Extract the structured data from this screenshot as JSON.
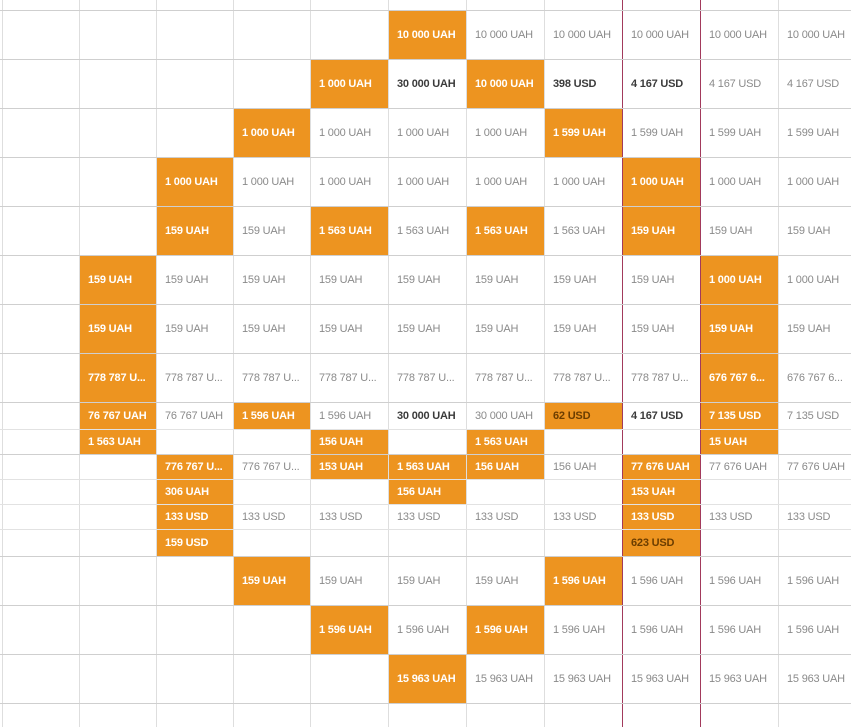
{
  "colors": {
    "highlight": "#ed9420",
    "marker_line": "#a23a5c",
    "grid": "#dedede",
    "text_muted": "#8a8a8a"
  },
  "grid": {
    "marker_columns": [
      8,
      9
    ],
    "rows": [
      {
        "cells": [
          null,
          null,
          null,
          null,
          null,
          {
            "t": "10 000 UAH",
            "s": "hl"
          },
          {
            "t": "10 000 UAH"
          },
          {
            "t": "10 000 UAH"
          },
          {
            "t": "10 000 UAH"
          },
          {
            "t": "10 000 UAH"
          },
          {
            "t": "10 000 UAH"
          }
        ]
      },
      {
        "cells": [
          null,
          null,
          null,
          null,
          {
            "t": "1 000 UAH",
            "s": "hl"
          },
          {
            "t": "30 000 UAH",
            "s": "bold"
          },
          {
            "t": "10 000 UAH",
            "s": "hl"
          },
          {
            "t": "398 USD",
            "s": "bold"
          },
          {
            "t": "4 167 USD",
            "s": "bold"
          },
          {
            "t": "4 167 USD"
          },
          {
            "t": "4 167 USD"
          }
        ]
      },
      {
        "cells": [
          null,
          null,
          null,
          {
            "t": "1 000 UAH",
            "s": "hl"
          },
          {
            "t": "1 000 UAH"
          },
          {
            "t": "1 000 UAH"
          },
          {
            "t": "1 000 UAH"
          },
          {
            "t": "1 599 UAH",
            "s": "hl"
          },
          {
            "t": "1 599 UAH"
          },
          {
            "t": "1 599 UAH"
          },
          {
            "t": "1 599 UAH"
          }
        ]
      },
      {
        "cells": [
          null,
          null,
          {
            "t": "1 000 UAH",
            "s": "hl"
          },
          {
            "t": "1 000 UAH"
          },
          {
            "t": "1 000 UAH"
          },
          {
            "t": "1 000 UAH"
          },
          {
            "t": "1 000 UAH"
          },
          {
            "t": "1 000 UAH"
          },
          {
            "t": "1 000 UAH",
            "s": "hl"
          },
          {
            "t": "1 000 UAH"
          },
          {
            "t": "1 000 UAH"
          }
        ]
      },
      {
        "cells": [
          null,
          null,
          {
            "t": "159 UAH",
            "s": "hl"
          },
          {
            "t": "159 UAH"
          },
          {
            "t": "1 563 UAH",
            "s": "hl"
          },
          {
            "t": "1 563 UAH"
          },
          {
            "t": "1 563 UAH",
            "s": "hl"
          },
          {
            "t": "1 563 UAH"
          },
          {
            "t": "159 UAH",
            "s": "hl"
          },
          {
            "t": "159 UAH"
          },
          {
            "t": "159 UAH"
          }
        ]
      },
      {
        "cells": [
          null,
          {
            "t": "159 UAH",
            "s": "hl"
          },
          {
            "t": "159 UAH"
          },
          {
            "t": "159 UAH"
          },
          {
            "t": "159 UAH"
          },
          {
            "t": "159 UAH"
          },
          {
            "t": "159 UAH"
          },
          {
            "t": "159 UAH"
          },
          {
            "t": "159 UAH"
          },
          {
            "t": "1 000 UAH",
            "s": "hl"
          },
          {
            "t": "1 000 UAH"
          }
        ]
      },
      {
        "cells": [
          null,
          {
            "t": "159 UAH",
            "s": "hl"
          },
          {
            "t": "159 UAH"
          },
          {
            "t": "159 UAH"
          },
          {
            "t": "159 UAH"
          },
          {
            "t": "159 UAH"
          },
          {
            "t": "159 UAH"
          },
          {
            "t": "159 UAH"
          },
          {
            "t": "159 UAH"
          },
          {
            "t": "159 UAH",
            "s": "hl"
          },
          {
            "t": "159 UAH"
          }
        ]
      },
      {
        "cells": [
          null,
          {
            "t": "778 787 U...",
            "s": "hl"
          },
          {
            "t": "778 787 U..."
          },
          {
            "t": "778 787 U..."
          },
          {
            "t": "778 787 U..."
          },
          {
            "t": "778 787 U..."
          },
          {
            "t": "778 787 U..."
          },
          {
            "t": "778 787 U..."
          },
          {
            "t": "778 787 U..."
          },
          {
            "t": "676 767 6...",
            "s": "hl"
          },
          {
            "t": "676 767 6..."
          }
        ]
      },
      {
        "cells": [
          null,
          {
            "t": "76 767 UAH",
            "s": "hl"
          },
          {
            "t": "76 767 UAH"
          },
          {
            "t": "1 596 UAH",
            "s": "hl"
          },
          {
            "t": "1 596 UAH"
          },
          {
            "t": "30 000 UAH",
            "s": "bold"
          },
          {
            "t": "30 000 UAH"
          },
          {
            "t": "62 USD",
            "s": "hl bold"
          },
          {
            "t": "4 167 USD",
            "s": "bold"
          },
          {
            "t": "7 135 USD",
            "s": "hl"
          },
          {
            "t": "7 135 USD"
          }
        ]
      },
      {
        "cells": [
          null,
          {
            "t": "1 563 UAH",
            "s": "hl"
          },
          null,
          null,
          {
            "t": "156 UAH",
            "s": "hl"
          },
          null,
          {
            "t": "1 563 UAH",
            "s": "hl"
          },
          null,
          null,
          {
            "t": "15 UAH",
            "s": "hl"
          },
          null
        ]
      },
      {
        "cells": [
          null,
          null,
          {
            "t": "776 767 U...",
            "s": "hl"
          },
          {
            "t": "776 767 U..."
          },
          {
            "t": "153 UAH",
            "s": "hl"
          },
          {
            "t": "1 563 UAH",
            "s": "hl"
          },
          {
            "t": "156 UAH",
            "s": "hl"
          },
          {
            "t": "156 UAH"
          },
          {
            "t": "77 676 UAH",
            "s": "hl"
          },
          {
            "t": "77 676 UAH"
          },
          {
            "t": "77 676 UAH"
          }
        ]
      },
      {
        "cells": [
          null,
          null,
          {
            "t": "306 UAH",
            "s": "hl"
          },
          null,
          null,
          {
            "t": "156 UAH",
            "s": "hl"
          },
          null,
          null,
          {
            "t": "153 UAH",
            "s": "hl"
          },
          null,
          null
        ]
      },
      {
        "cells": [
          null,
          null,
          {
            "t": "133 USD",
            "s": "hl"
          },
          {
            "t": "133 USD"
          },
          {
            "t": "133 USD"
          },
          {
            "t": "133 USD"
          },
          {
            "t": "133 USD"
          },
          {
            "t": "133 USD"
          },
          {
            "t": "133 USD",
            "s": "hl"
          },
          {
            "t": "133 USD"
          },
          {
            "t": "133 USD"
          }
        ]
      },
      {
        "cells": [
          null,
          null,
          {
            "t": "159 USD",
            "s": "hl"
          },
          null,
          null,
          null,
          null,
          null,
          {
            "t": "623 USD",
            "s": "hl bold"
          },
          null,
          null
        ]
      },
      {
        "cells": [
          null,
          null,
          null,
          {
            "t": "159 UAH",
            "s": "hl"
          },
          {
            "t": "159 UAH"
          },
          {
            "t": "159 UAH"
          },
          {
            "t": "159 UAH"
          },
          {
            "t": "1 596 UAH",
            "s": "hl"
          },
          {
            "t": "1 596 UAH"
          },
          {
            "t": "1 596 UAH"
          },
          {
            "t": "1 596 UAH"
          }
        ]
      },
      {
        "cells": [
          null,
          null,
          null,
          null,
          {
            "t": "1 596 UAH",
            "s": "hl"
          },
          {
            "t": "1 596 UAH"
          },
          {
            "t": "1 596 UAH",
            "s": "hl"
          },
          {
            "t": "1 596 UAH"
          },
          {
            "t": "1 596 UAH"
          },
          {
            "t": "1 596 UAH"
          },
          {
            "t": "1 596 UAH"
          }
        ]
      },
      {
        "cells": [
          null,
          null,
          null,
          null,
          null,
          {
            "t": "15 963 UAH",
            "s": "hl"
          },
          {
            "t": "15 963 UAH"
          },
          {
            "t": "15 963 UAH"
          },
          {
            "t": "15 963 UAH"
          },
          {
            "t": "15 963 UAH"
          },
          {
            "t": "15 963 UAH"
          }
        ]
      },
      {
        "cells": [
          null,
          null,
          null,
          null,
          null,
          null,
          null,
          null,
          null,
          null,
          null
        ]
      }
    ]
  }
}
